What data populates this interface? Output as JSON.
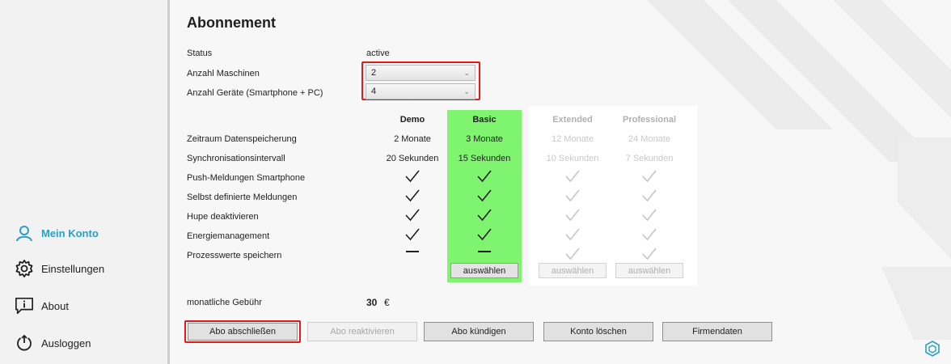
{
  "sidebar": {
    "items": [
      {
        "label": "Mein Konto",
        "icon": "user-icon",
        "active": true
      },
      {
        "label": "Einstellungen",
        "icon": "gear-icon"
      },
      {
        "label": "About",
        "icon": "info-icon"
      },
      {
        "label": "Ausloggen",
        "icon": "power-icon"
      }
    ]
  },
  "main": {
    "title": "Abonnement",
    "status_label": "Status",
    "status_value": "active",
    "machines_label": "Anzahl Maschinen",
    "machines_value": "2",
    "devices_label": "Anzahl Geräte (Smartphone + PC)",
    "devices_value": "4"
  },
  "plans": {
    "headers": [
      "Demo",
      "Basic",
      "Extended",
      "Professional"
    ],
    "features": [
      {
        "label": "Zeitraum Datenspeicherung",
        "values": [
          "2 Monate",
          "3 Monate",
          "12 Monate",
          "24 Monate"
        ]
      },
      {
        "label": "Synchronisationsintervall",
        "values": [
          "20 Sekunden",
          "15 Sekunden",
          "10 Sekunden",
          "7 Sekunden"
        ]
      },
      {
        "label": "Push-Meldungen Smartphone",
        "values": [
          "check",
          "check",
          "check",
          "check"
        ]
      },
      {
        "label": "Selbst definierte Meldungen",
        "values": [
          "check",
          "check",
          "check",
          "check"
        ]
      },
      {
        "label": "Hupe deaktivieren",
        "values": [
          "check",
          "check",
          "check",
          "check"
        ]
      },
      {
        "label": "Energiemanagement",
        "values": [
          "check",
          "check",
          "check",
          "check"
        ]
      },
      {
        "label": "Prozesswerte speichern",
        "values": [
          "dash",
          "dash",
          "check",
          "check"
        ]
      }
    ],
    "select_label": "auswählen",
    "selected_plan": "Basic",
    "highlight_color": "#7ff46e"
  },
  "fee": {
    "label": "monatliche Gebühr",
    "value": "30",
    "currency": "€"
  },
  "actions": {
    "subscribe": "Abo abschließen",
    "reactivate": "Abo reaktivieren",
    "cancel": "Abo kündigen",
    "delete_account": "Konto löschen",
    "company_data": "Firmendaten"
  },
  "colors": {
    "accent": "#2a9fc6",
    "highlight_border": "#e11b1b"
  }
}
